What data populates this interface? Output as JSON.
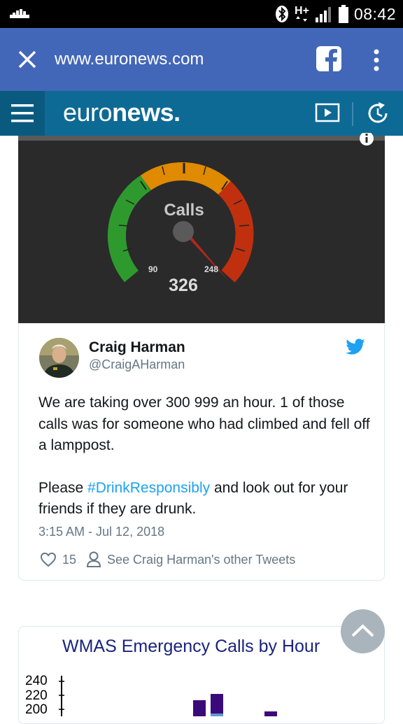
{
  "status_bar": {
    "network": "H+",
    "time": "08:42"
  },
  "browser": {
    "url": "www.euronews.com"
  },
  "site": {
    "logo_light": "euro",
    "logo_bold": "news",
    "logo_dot": "."
  },
  "gauge": {
    "title": "Calls",
    "value": "326",
    "yellow_threshold": "90",
    "red_threshold": "248",
    "colors": {
      "green": "#2e9a2e",
      "yellow": "#e08a00",
      "red": "#c0300f",
      "needle": "#b5261c"
    }
  },
  "tweet": {
    "author_name": "Craig Harman",
    "author_handle": "@CraigAHarman",
    "text_line1": "We are taking over 300 999 an hour. 1 of those calls was for someone who had climbed and fell off a lamppost.",
    "text_pre_hashtag": "Please ",
    "hashtag": "#DrinkResponsibly",
    "text_post_hashtag": " and look out for your friends if they are drunk.",
    "date": "3:15 AM - Jul 12, 2018",
    "likes": "15",
    "other_tweets_label": "See Craig Harman's other Tweets"
  },
  "chart_card": {
    "title": "WMAS Emergency Calls by Hour",
    "y_ticks": [
      "240",
      "220",
      "200"
    ]
  },
  "chart_data": {
    "type": "bar",
    "title": "WMAS Emergency Calls by Hour",
    "yticks": [
      240,
      220,
      200
    ],
    "series_colors": [
      "#3a0a7a",
      "#5b9bd5"
    ]
  }
}
